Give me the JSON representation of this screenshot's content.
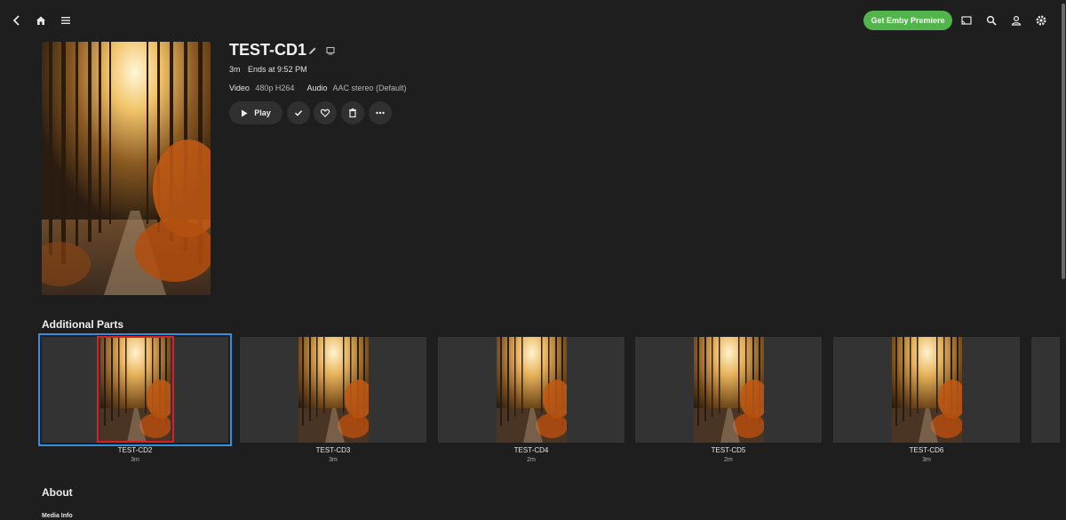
{
  "header": {
    "premiere_label": "Get Emby Premiere",
    "icons": [
      "back-icon",
      "home-icon",
      "menu-icon",
      "cast-icon",
      "search-icon",
      "user-icon",
      "settings-icon"
    ]
  },
  "item": {
    "title": "TEST-CD1",
    "runtime": "3m",
    "ends_at": "Ends at 9:52 PM",
    "video_label": "Video",
    "video_value": "480p H264",
    "audio_label": "Audio",
    "audio_value": "AAC stereo (Default)",
    "play_label": "Play"
  },
  "additional_parts": {
    "heading": "Additional Parts",
    "items": [
      {
        "title": "TEST-CD2",
        "runtime": "3m"
      },
      {
        "title": "TEST-CD3",
        "runtime": "3m"
      },
      {
        "title": "TEST-CD4",
        "runtime": "2m"
      },
      {
        "title": "TEST-CD5",
        "runtime": "2m"
      },
      {
        "title": "TEST-CD6",
        "runtime": "3m"
      }
    ]
  },
  "about": {
    "heading": "About",
    "media_info": "Media Info"
  },
  "colors": {
    "background": "#1e1e1e",
    "accent_green": "#52b54b",
    "selection_blue": "#2f8fe0",
    "highlight_red": "#e01e1e"
  }
}
